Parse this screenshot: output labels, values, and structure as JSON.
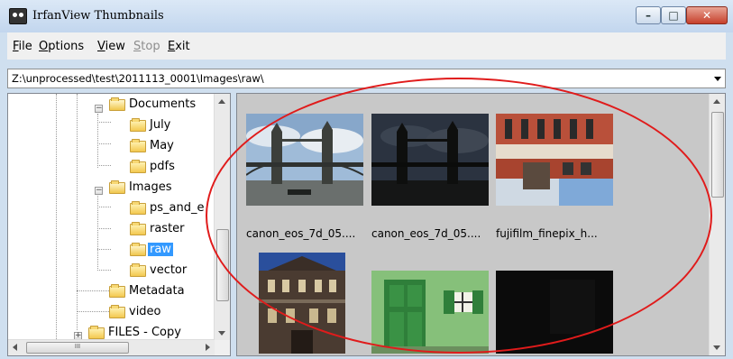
{
  "window": {
    "title": "IrfanView Thumbnails",
    "controls": {
      "minimize": "–",
      "maximize": "□",
      "close": "✕"
    }
  },
  "menu": [
    {
      "label": "File",
      "mnemonic": "F",
      "rest": "ile",
      "enabled": true
    },
    {
      "label": "Options",
      "mnemonic": "O",
      "rest": "ptions",
      "enabled": true
    },
    {
      "label": "View",
      "mnemonic": "V",
      "rest": "iew",
      "enabled": true
    },
    {
      "label": "Stop",
      "mnemonic": "S",
      "rest": "top",
      "enabled": false
    },
    {
      "label": "Exit",
      "mnemonic": "E",
      "rest": "xit",
      "enabled": true
    }
  ],
  "path": {
    "value": "Z:\\unprocessed\\test\\2011113_0001\\Images\\raw\\"
  },
  "tree": {
    "items": [
      {
        "label": "Documents",
        "expanded": true
      },
      {
        "label": "July"
      },
      {
        "label": "May"
      },
      {
        "label": "pdfs"
      },
      {
        "label": "Images",
        "expanded": true
      },
      {
        "label": "ps_and_e"
      },
      {
        "label": "raster"
      },
      {
        "label": "raw",
        "selected": true
      },
      {
        "label": "vector"
      },
      {
        "label": "Metadata"
      },
      {
        "label": "video"
      },
      {
        "label": "FILES - Copy",
        "expanded": false
      }
    ],
    "hscroll_grip": "III"
  },
  "thumbnails": [
    {
      "caption": "canon_eos_7d_05....",
      "image": "tower-bridge-day"
    },
    {
      "caption": "canon_eos_7d_05....",
      "image": "tower-bridge-dark"
    },
    {
      "caption": "fujifilm_finepix_h...",
      "image": "brick-building-rotated"
    },
    {
      "caption": "",
      "image": "victorian-building"
    },
    {
      "caption": "",
      "image": "green-door"
    },
    {
      "caption": "",
      "image": "black-frame"
    }
  ],
  "colors": {
    "selection": "#3399ff",
    "annotation": "#e01b1b",
    "grid_bg": "#c8c8c8"
  }
}
